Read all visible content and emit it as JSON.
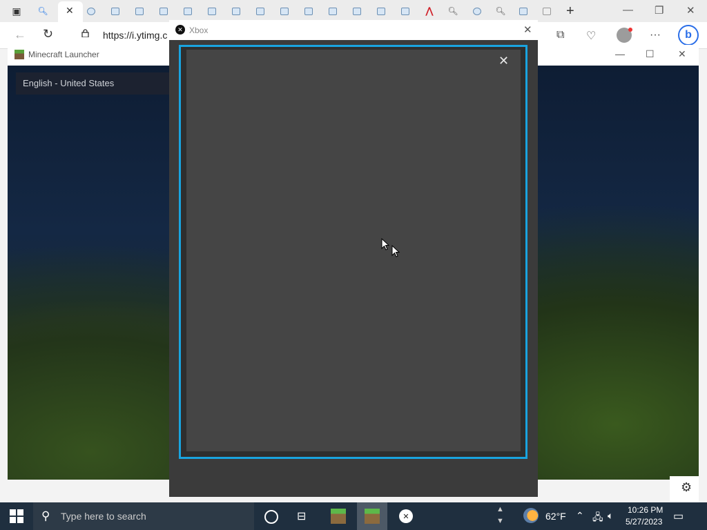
{
  "browser": {
    "url": "https://i.ytimg.c",
    "active_tab_close": "✕",
    "new_tab": "+",
    "minimize": "—",
    "restore": "❐",
    "close": "✕",
    "back": "←",
    "reload": "↻",
    "more": "···",
    "bing": "b"
  },
  "minecraft": {
    "title": "Minecraft Launcher",
    "language": "English - United States",
    "minimize": "—",
    "maximize": "☐",
    "close": "✕",
    "settings_icon": "⚙"
  },
  "xbox": {
    "title": "Xbox",
    "close": "✕",
    "panel_close": "✕",
    "frame_color": "#19a4e0"
  },
  "taskbar": {
    "search_placeholder": "Type here to search",
    "temperature": "62°F",
    "time": "10:26 PM",
    "date": "5/27/2023",
    "apps": [
      "minecraft",
      "minecraft-launcher",
      "xbox"
    ]
  }
}
